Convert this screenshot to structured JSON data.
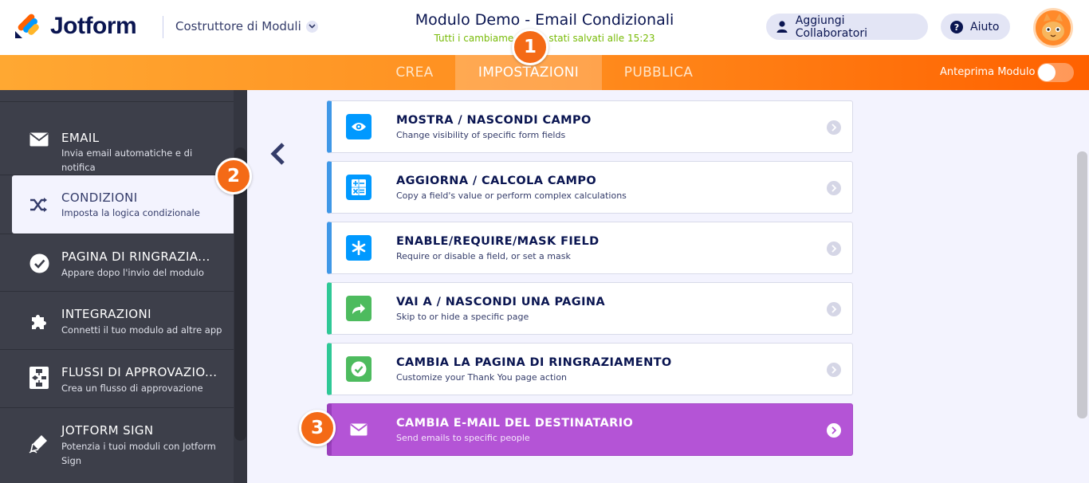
{
  "header": {
    "logo_text": "Jotform",
    "builder_menu_label": "Costruttore di Moduli",
    "form_title": "Modulo Demo - Email Condizionali",
    "save_status": "Tutti i cambiame",
    "save_status_end": "stati salvati alle 15:23",
    "collaborators_label": "Aggiungi Collaboratori",
    "help_label": "Aiuto"
  },
  "nav": {
    "tabs": [
      {
        "label": "CREA"
      },
      {
        "label": "IMPOSTAZIONI"
      },
      {
        "label": "PUBBLICA"
      }
    ],
    "active_tab": "IMPOSTAZIONI",
    "preview_label": "Anteprima Modulo",
    "preview_enabled": false
  },
  "sidebar": {
    "items": [
      {
        "title": "EMAIL",
        "desc": "Invia email automatiche e di notifica",
        "icon": "envelope-icon"
      },
      {
        "title": "CONDIZIONI",
        "desc": "Imposta la logica condizionale",
        "icon": "shuffle-icon"
      },
      {
        "title": "PAGINA DI RINGRAZIA...",
        "desc": "Appare dopo l'invio del modulo",
        "icon": "check-circle-icon"
      },
      {
        "title": "INTEGRAZIONI",
        "desc": "Connetti il tuo modulo ad altre app",
        "icon": "puzzle-icon"
      },
      {
        "title": "FLUSSI DI APPROVAZIO...",
        "desc": "Crea un flusso di approvazione",
        "icon": "flow-icon"
      },
      {
        "title": "JOTFORM SIGN",
        "desc": "Potenzia i tuoi moduli con Jotform Sign",
        "icon": "pen-icon"
      }
    ],
    "active_item": "CONDIZIONI"
  },
  "conditions": {
    "cards": [
      {
        "title": "MOSTRA / NASCONDI CAMPO",
        "desc": "Change visibility of specific form fields",
        "icon": "eye-icon",
        "accent": "#3f97e7"
      },
      {
        "title": "AGGIORNA / CALCOLA CAMPO",
        "desc": "Copy a field's value or perform complex calculations",
        "icon": "calculator-icon",
        "accent": "#3f97e7"
      },
      {
        "title": "ENABLE/REQUIRE/MASK FIELD",
        "desc": "Require or disable a field, or set a mask",
        "icon": "asterisk-icon",
        "accent": "#3f97e7"
      },
      {
        "title": "VAI A / NASCONDI UNA PAGINA",
        "desc": "Skip to or hide a specific page",
        "icon": "share-arrow-icon",
        "accent": "#2ec896"
      },
      {
        "title": "CAMBIA LA PAGINA DI RINGRAZIAMENTO",
        "desc": "Customize your Thank You page action",
        "icon": "check-icon",
        "accent": "#2ec896"
      },
      {
        "title": "CAMBIA E-MAIL DEL DESTINATARIO",
        "desc": "Send emails to specific people",
        "icon": "envelope-icon",
        "accent": "#b454d6"
      }
    ]
  },
  "steps": {
    "one": "1",
    "two": "2",
    "three": "3"
  },
  "colors": {
    "brand_orange": "#ff6100",
    "navy": "#0a1551",
    "sidebar_bg": "#3d3f4a",
    "blue_accent": "#3f97e7",
    "green_accent": "#2ec896",
    "purple_accent": "#b454d6",
    "step_badge": "#f46a16"
  }
}
